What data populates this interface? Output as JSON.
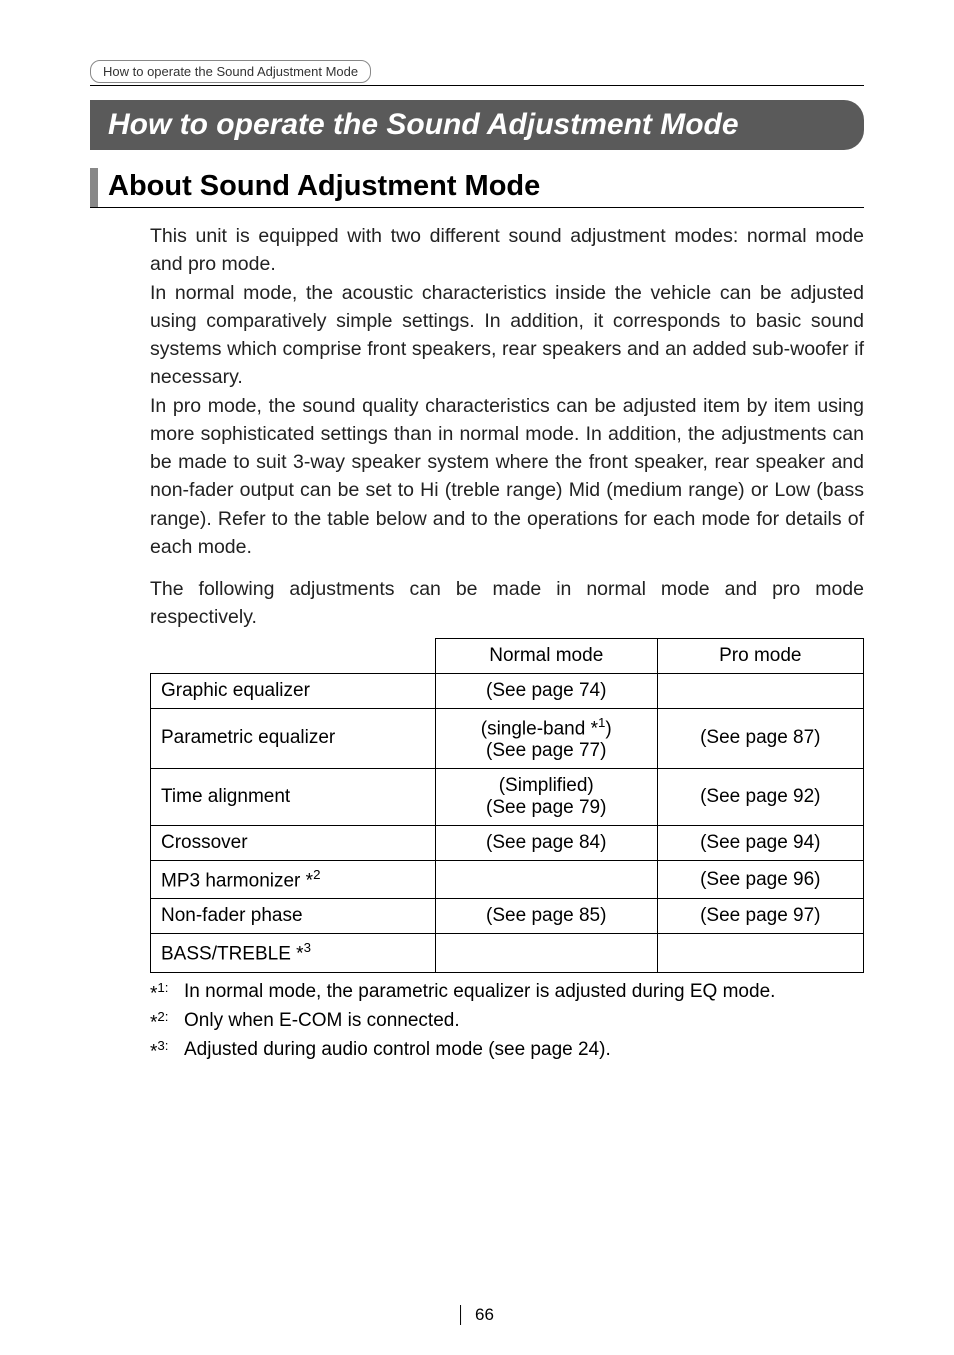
{
  "breadcrumb": "How to operate the Sound Adjustment Mode",
  "title": "How to operate the Sound Adjustment Mode",
  "section_heading": "About Sound Adjustment Mode",
  "paragraphs": {
    "p1": "This unit is equipped with two different sound adjustment modes: normal mode and pro mode.",
    "p2": "In normal mode, the acoustic characteristics inside the vehicle can be adjusted using comparatively simple settings. In addition, it corresponds to basic sound systems which comprise front speakers, rear speakers and an added sub-woofer if necessary.",
    "p3": "In pro mode, the sound quality characteristics can be adjusted item by item using more sophisticated settings than in normal mode. In addition, the adjustments can be made to suit 3-way speaker system where the front speaker, rear speaker and non-fader output can be set to Hi (treble range) Mid (medium range) or Low (bass range). Refer to the table below and to the operations for each mode for details of each mode.",
    "p4": "The following adjustments can be made in normal mode and pro mode respectively."
  },
  "table": {
    "headers": {
      "col1": "",
      "col2": "Normal mode",
      "col3": "Pro mode"
    },
    "rows": [
      {
        "label": "Graphic equalizer",
        "normal": "(See page 74)",
        "pro": ""
      },
      {
        "label": "Parametric equalizer",
        "normal_line1": "(single-band *",
        "normal_sup": "1",
        "normal_line1_end": ")",
        "normal_line2": "(See page 77)",
        "pro": "(See page 87)"
      },
      {
        "label": "Time alignment",
        "normal_line1": "(Simplified)",
        "normal_line2": "(See page 79)",
        "pro": "(See page 92)"
      },
      {
        "label": "Crossover",
        "normal": "(See page 84)",
        "pro": "(See page 94)"
      },
      {
        "label_prefix": "MP3 harmonizer *",
        "label_sup": "2",
        "normal": "",
        "pro": "(See page 96)"
      },
      {
        "label": "Non-fader phase",
        "normal": "(See page 85)",
        "pro": "(See page 97)"
      },
      {
        "label_prefix": "BASS/TREBLE *",
        "label_sup": "3",
        "normal": "",
        "pro": ""
      }
    ]
  },
  "footnotes": {
    "fn1_label": "*",
    "fn1_sup": "1:",
    "fn1_text": "In normal mode, the parametric equalizer is adjusted during EQ mode.",
    "fn2_label": "*",
    "fn2_sup": "2:",
    "fn2_text": "Only when E-COM is connected.",
    "fn3_label": "*",
    "fn3_sup": "3:",
    "fn3_text": "Adjusted during audio control mode (see page 24)."
  },
  "page_number": "66"
}
